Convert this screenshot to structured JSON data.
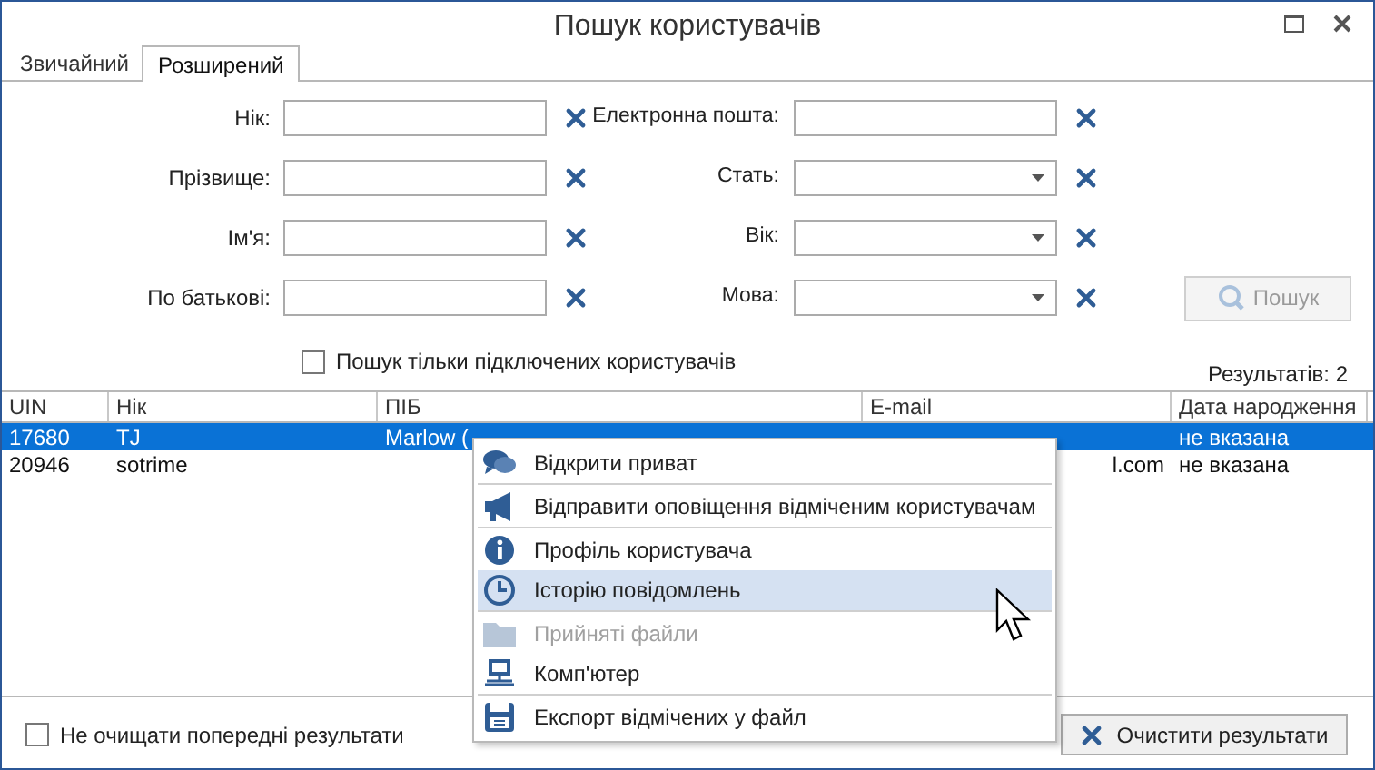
{
  "window": {
    "title": "Пошук користувачів"
  },
  "tabs": [
    {
      "label": "Звичайний",
      "selected": false
    },
    {
      "label": "Розширений",
      "selected": true
    }
  ],
  "form": {
    "rows": [
      [
        {
          "label": "Нік:",
          "kind": "text"
        },
        {
          "label": "Електронна пошта:",
          "kind": "text"
        }
      ],
      [
        {
          "label": "Прізвище:",
          "kind": "text"
        },
        {
          "label": "Стать:",
          "kind": "dropdown"
        }
      ],
      [
        {
          "label": "Ім'я:",
          "kind": "text"
        },
        {
          "label": "Вік:",
          "kind": "dropdown"
        }
      ],
      [
        {
          "label": "По батькові:",
          "kind": "text"
        },
        {
          "label": "Мова:",
          "kind": "dropdown"
        }
      ]
    ],
    "online_only": {
      "label": "Пошук тільки підключених користувачів",
      "checked": false
    },
    "search_button": {
      "label": "Пошук",
      "disabled": true
    },
    "results_count": "Результатів: 2"
  },
  "table": {
    "columns": [
      "UIN",
      "Нік",
      "ПІБ",
      "E-mail",
      "Дата народження"
    ],
    "rows": [
      {
        "cells": [
          "17680",
          "TJ",
          "Marlow (",
          "",
          "не вказана"
        ],
        "selected": true
      },
      {
        "cells": [
          "20946",
          "sotrime",
          "",
          "l.com",
          "не вказана"
        ],
        "selected": false
      }
    ]
  },
  "context_menu": {
    "groups": [
      [
        {
          "label": "Відкрити приват",
          "kind": "chat",
          "disabled": false,
          "selected": false
        }
      ],
      [
        {
          "label": "Відправити оповіщення відміченим користувачам",
          "kind": "megaphone",
          "disabled": false,
          "selected": false
        }
      ],
      [
        {
          "label": "Профіль користувача",
          "kind": "info",
          "disabled": false,
          "selected": false
        },
        {
          "label": "Історію повідомлень",
          "kind": "clock",
          "disabled": false,
          "selected": true
        }
      ],
      [
        {
          "label": "Прийняті файли",
          "kind": "folder",
          "disabled": true,
          "selected": false
        },
        {
          "label": "Комп'ютер",
          "kind": "computer",
          "disabled": false,
          "selected": false
        }
      ],
      [
        {
          "label": "Експорт відмічених у файл",
          "kind": "save",
          "disabled": false,
          "selected": false
        }
      ]
    ]
  },
  "bottom": {
    "keep_results": {
      "label": "Не очищати попередні результати",
      "checked": false
    },
    "clear_button": {
      "label": "Очистити результати"
    }
  }
}
